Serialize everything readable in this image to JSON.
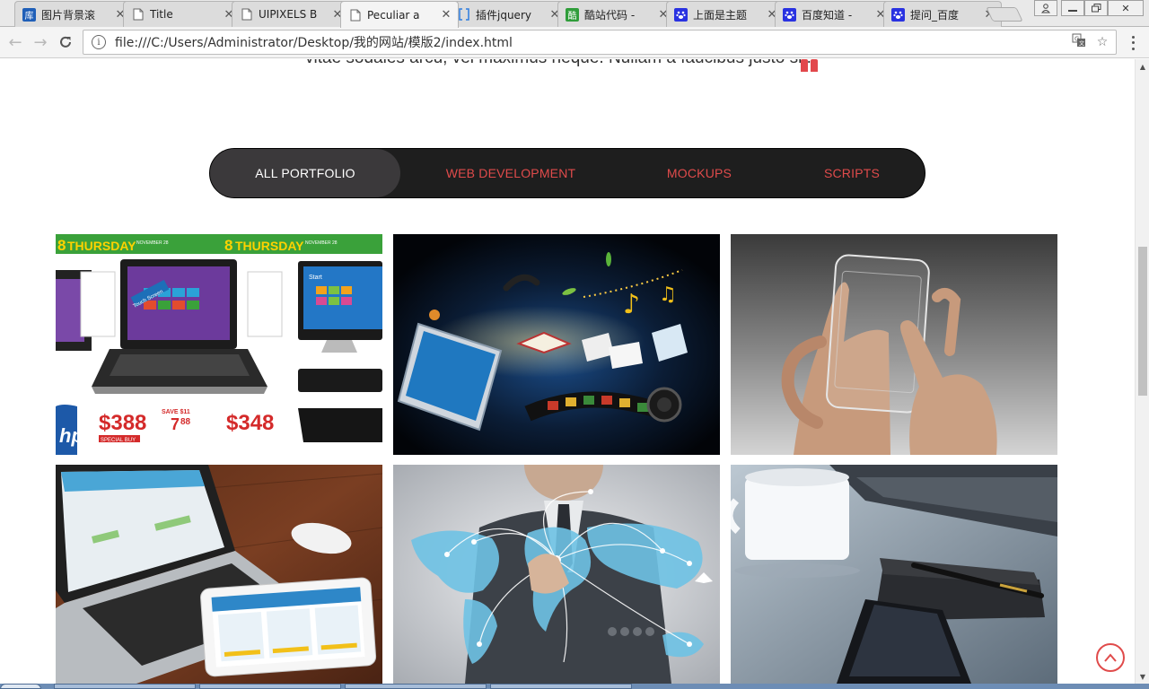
{
  "browser": {
    "tabs": [
      {
        "title": "图片背景滚",
        "favicon": "ku-icon",
        "favicon_text": "库",
        "favicon_color": "#1f5fb8",
        "active": false
      },
      {
        "title": "Title",
        "favicon": "page-icon",
        "favicon_text": "",
        "favicon_color": "",
        "active": false
      },
      {
        "title": "UIPIXELS B",
        "favicon": "page-icon",
        "favicon_text": "",
        "favicon_color": "",
        "active": false
      },
      {
        "title": "Peculiar a",
        "favicon": "page-icon",
        "favicon_text": "",
        "favicon_color": "",
        "active": true
      },
      {
        "title": "插件jquery",
        "favicon": "bracket-icon",
        "favicon_text": "",
        "favicon_color": "#2d7de0",
        "active": false
      },
      {
        "title": "酷站代码 -",
        "favicon": "kuzhan-icon",
        "favicon_text": "酷",
        "favicon_color": "#2f9d3a",
        "active": false
      },
      {
        "title": "上面是主题",
        "favicon": "baidu-paw-icon",
        "favicon_text": "",
        "favicon_color": "#2932e1",
        "active": false
      },
      {
        "title": "百度知道 -",
        "favicon": "baidu-paw-icon",
        "favicon_text": "",
        "favicon_color": "#2932e1",
        "active": false
      },
      {
        "title": "提问_百度",
        "favicon": "baidu-paw-icon",
        "favicon_text": "",
        "favicon_color": "#2932e1",
        "active": false
      }
    ],
    "url": "file:///C:/Users/Administrator/Desktop/我的网站/模版2/index.html"
  },
  "page": {
    "clipped_text": "vitae sodales arcu, vel maximus neque. Nullam a faucibus justo sit.",
    "filters": [
      {
        "label": "ALL PORTFOLIO",
        "active": true
      },
      {
        "label": "WEB DEVELOPMENT",
        "active": false
      },
      {
        "label": "MOCKUPS",
        "active": false
      },
      {
        "label": "SCRIPTS",
        "active": false
      }
    ],
    "portfolio": {
      "laptop_ad": {
        "headline": "THURSDAY",
        "date": "NOVEMBER 28",
        "day_number": "8",
        "price_left": "$388",
        "price_right": "$348",
        "price_mid": "7",
        "price_mid_cents": "88",
        "save_text": "SAVE $11",
        "special_text": "SPECIAL BUY",
        "touch_text": "Touch Screen",
        "brand": "hp",
        "start_text": "Start"
      }
    }
  },
  "colors": {
    "accent": "#e04b4b",
    "filter_bg": "#1e1e1e",
    "filter_active_bg": "#3b393b"
  }
}
